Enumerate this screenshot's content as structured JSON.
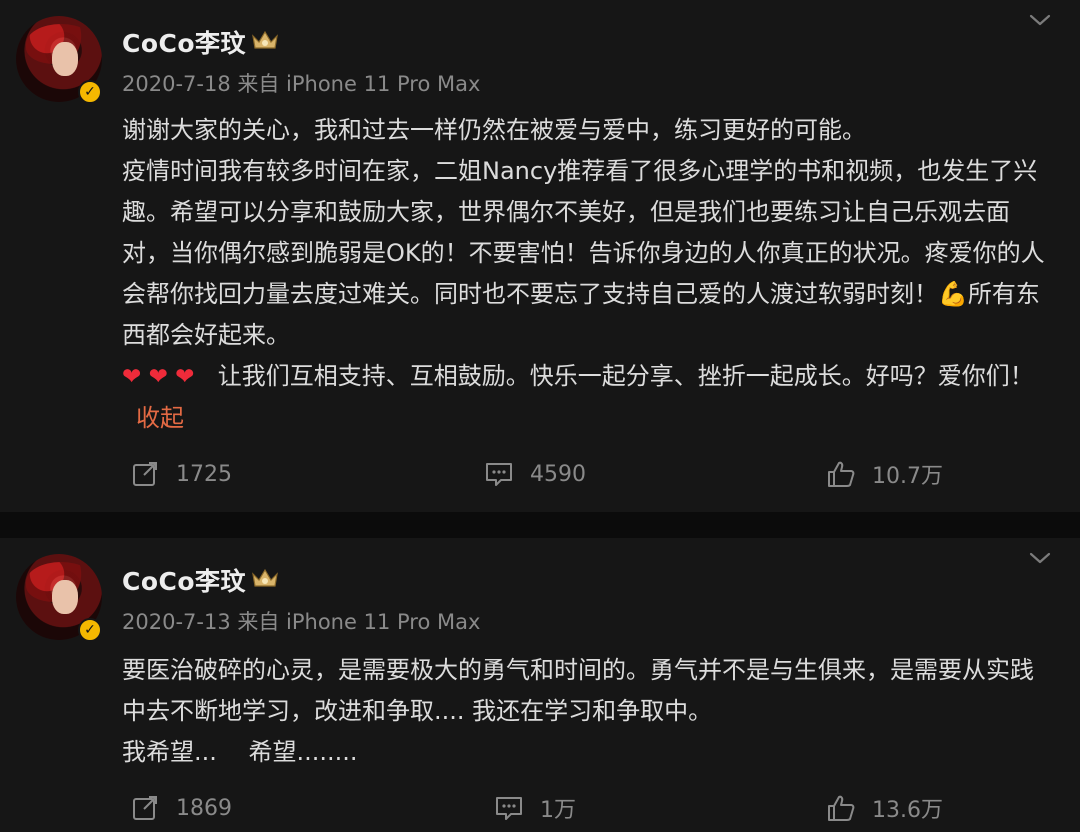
{
  "posts": [
    {
      "author": "CoCo李玟",
      "meta": "2020-7-18 来自 iPhone 11 Pro Max",
      "body": [
        "谢谢大家的关心，我和过去一样仍然在被爱与爱中，练习更好的可能。",
        "疫情时间我有较多时间在家，二姐Nancy推荐看了很多心理学的书和视频，也发生了兴趣。希望可以分享和鼓励大家，世界偶尔不美好，但是我们也要练习让自己乐观去面对，当你偶尔感到脆弱是OK的！不要害怕！告诉你身边的人你真正的状况。疼爱你的人会帮你找回力量去度过难关。同时也不要忘了支持自己爱的人渡过软弱时刻！💪所有东西都会好起来。",
        "让我们互相支持、互相鼓励。快乐一起分享、挫折一起成长。好吗？爱你们！"
      ],
      "hearts": "❤ ❤ ❤",
      "collapse_label": "收起",
      "reposts": "1725",
      "comments": "4590",
      "likes": "10.7万"
    },
    {
      "author": "CoCo李玟",
      "meta": "2020-7-13 来自 iPhone 11 Pro Max",
      "body": [
        "要医治破碎的心灵，是需要极大的勇气和时间的。勇气并不是与生俱来，是需要从实践中去不断地学习，改进和争取.... 我还在学习和争取中。",
        "我希望...　 希望........"
      ],
      "reposts": "1869",
      "comments": "1万",
      "likes": "13.6万"
    }
  ],
  "colors": {
    "accent": "#e46a44",
    "verified": "#f5b800",
    "heart": "#ef2b3a"
  },
  "icons": [
    "verified-badge-icon",
    "vip-crown-icon",
    "chevron-down-icon",
    "repost-icon",
    "comment-icon",
    "like-icon"
  ]
}
